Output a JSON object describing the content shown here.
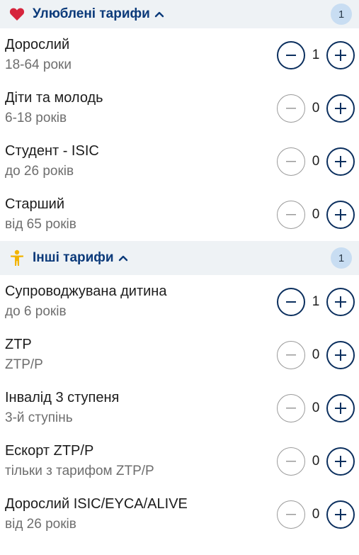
{
  "sections": [
    {
      "title": "Улюблені тарифи",
      "badge": "1",
      "icon": "heart-icon",
      "items": [
        {
          "title": "Дорослий",
          "sub": "18-64 роки",
          "qty": "1"
        },
        {
          "title": "Діти та молодь",
          "sub": "6-18 років",
          "qty": "0"
        },
        {
          "title": "Студент - ISIC",
          "sub": "до 26 років",
          "qty": "0"
        },
        {
          "title": "Старший",
          "sub": "від 65 років",
          "qty": "0"
        }
      ]
    },
    {
      "title": "Інші тарифи",
      "badge": "1",
      "icon": "person-icon",
      "items": [
        {
          "title": "Супроводжувана дитина",
          "sub": "до 6 років",
          "qty": "1"
        },
        {
          "title": "ZTP",
          "sub": "ZTP/P",
          "qty": "0"
        },
        {
          "title": "Інвалід 3 ступеня",
          "sub": "3-й ступінь",
          "qty": "0"
        },
        {
          "title": "Ескорт ZTP/P",
          "sub": "тільки з тарифом ZTP/P",
          "qty": "0"
        },
        {
          "title": "Дорослий ISIC/EYCA/ALIVE",
          "sub": "від 26 років",
          "qty": "0"
        }
      ]
    }
  ],
  "colors": {
    "accent": "#0b3a7a",
    "heart": "#d6243c",
    "person": "#f2b400",
    "badge_bg": "#c8ddf2",
    "header_bg": "#eef2f5"
  }
}
